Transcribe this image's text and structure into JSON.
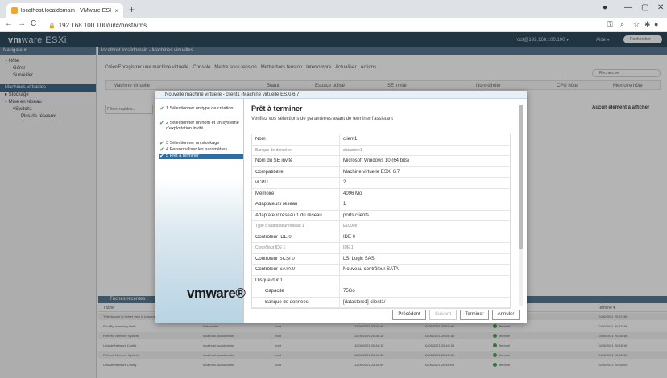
{
  "browser": {
    "tab_title": "localhost.localdomain - VMware ESXi",
    "close_glyph": "×",
    "new_tab_glyph": "+",
    "url": "192.168.100.100/ui/#/host/vms",
    "back": "←",
    "forward": "→",
    "reload": "C"
  },
  "esxi": {
    "logo_vm": "vm",
    "logo_rest": "ware ESXi",
    "user": "root@192.168.100.100 ▾",
    "help": "Aide ▾",
    "search_placeholder": "Rechercher"
  },
  "navigator": {
    "title": "Navigateur",
    "items": [
      {
        "label": "▾ Hôte"
      },
      {
        "label": "Gérer"
      },
      {
        "label": "Surveiller"
      },
      {
        "label": "Machines virtuelles"
      },
      {
        "label": "▸ Stockage"
      },
      {
        "label": "▾ Mise en réseau"
      },
      {
        "label": "vSwitch1"
      },
      {
        "label": "Plus de réseaux..."
      }
    ]
  },
  "main": {
    "header": "localhost.localdomain - Machines virtuelles",
    "toolbar": [
      "Créer/Enregistrer une machine virtuelle",
      "Console",
      "Mettre sous tension",
      "Mettre hors tension",
      "Interrompre",
      "Actualiser",
      "Actions"
    ],
    "search_placeholder": "Rechercher",
    "columns": [
      "Machine virtuelle",
      "Statut",
      "Espace utilisé",
      "SE invité",
      "Nom d'hôte",
      "CPU hôte",
      "Mémoire hôte"
    ],
    "filter_placeholder": "Filtres rapides...",
    "no_items": "Aucun élément à afficher"
  },
  "tasks": {
    "title": "Tâches récentes",
    "col_task": "Tâche",
    "col_done": "Terminé ▾",
    "rows": [
      {
        "task": "Télécharger le fichier vers la banque de données",
        "target": "",
        "initiator": "",
        "queued": "",
        "started": "",
        "result": "",
        "done": "11/06/2021 20:57:46"
      },
      {
        "task": "Find By Inventory Path",
        "target": "Datacenter",
        "initiator": "root",
        "queued": "11/06/2021 20:57:46",
        "started": "11/06/2021 20:57:46",
        "result": "Terminé",
        "done": "11/06/2021 20:57:46"
      },
      {
        "task": "Refresh Network System",
        "target": "localhost.localdomain",
        "initiator": "root",
        "queued": "11/06/2021 20:48:16",
        "started": "11/06/2021 20:48:16",
        "result": "Terminé",
        "done": "11/06/2021 20:48:16"
      },
      {
        "task": "Update Network Config",
        "target": "localhost.localdomain",
        "initiator": "root",
        "queued": "11/06/2021 20:48:15",
        "started": "11/06/2021 20:48:15",
        "result": "Terminé",
        "done": "11/06/2021 20:48:15"
      },
      {
        "task": "Refresh Network System",
        "target": "localhost.localdomain",
        "initiator": "root",
        "queued": "11/06/2021 20:48:10",
        "started": "11/06/2021 20:48:10",
        "result": "Terminé",
        "done": "11/06/2021 20:48:10"
      },
      {
        "task": "Update Network Config",
        "target": "localhost.localdomain",
        "initiator": "root",
        "queued": "11/06/2021 20:48:09",
        "started": "11/06/2021 20:48:09",
        "result": "Terminé",
        "done": "11/06/2021 20:48:09"
      }
    ]
  },
  "dialog": {
    "title": "Nouvelle machine virtuelle - client1 (Machine virtuelle ESXi 6.7)",
    "steps": [
      {
        "label": "1 Sélectionner un type de création"
      },
      {
        "label": "2 Sélectionner un nom et un système d'exploitation invité"
      },
      {
        "label": "3 Sélectionner un stockage"
      },
      {
        "label": "4 Personnaliser les paramètres"
      },
      {
        "label": "5 Prêt à terminer"
      }
    ],
    "check_glyph": "✔",
    "logo": "vmware®",
    "heading": "Prêt à terminer",
    "subheading": "Vérifiez vos sélections de paramètres avant de terminer l'assistant",
    "rows": [
      {
        "k": "Nom",
        "v": "client1"
      },
      {
        "k": "Banque de données",
        "v": "datastore1"
      },
      {
        "k": "Nom du SE invité",
        "v": "Microsoft Windows 10 (64 bits)"
      },
      {
        "k": "Compatibilité",
        "v": "Machine virtuelle ESXi 6.7"
      },
      {
        "k": "vCPU",
        "v": "2"
      },
      {
        "k": "Mémoire",
        "v": "4096 Mo"
      },
      {
        "k": "Adaptateurs réseau",
        "v": "1"
      },
      {
        "k": "Adaptateur réseau 1 du réseau",
        "v": "ports clients"
      },
      {
        "k": "Type d'adaptateur réseau 1",
        "v": "E1000e"
      },
      {
        "k": "Contrôleur IDE 0",
        "v": "IDE 0"
      },
      {
        "k": "Contrôleur IDE 1",
        "v": "IDE 1"
      },
      {
        "k": "Contrôleur SCSI 0",
        "v": "LSI Logic SAS"
      },
      {
        "k": "Contrôleur SATA 0",
        "v": "Nouveau contrôleur SATA"
      },
      {
        "k": "Disque dur 1",
        "v": ""
      },
      {
        "k": "Capacité",
        "v": "75Go"
      },
      {
        "k": "Banque de données",
        "v": "[datastore1] client1/"
      }
    ],
    "buttons": {
      "prev": "Précédent",
      "next": "Suivant",
      "finish": "Terminer",
      "cancel": "Annuler"
    }
  }
}
